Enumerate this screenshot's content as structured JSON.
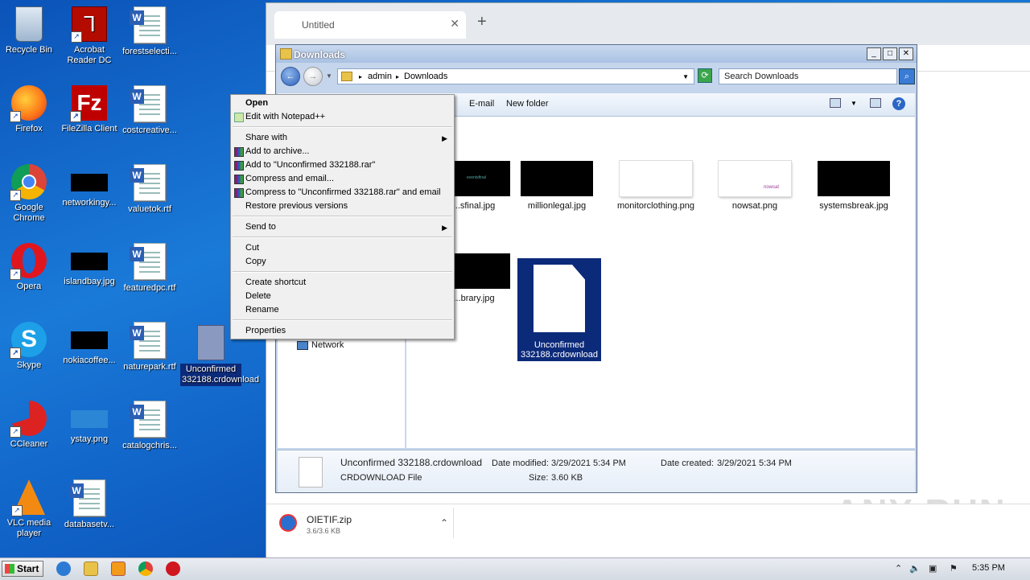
{
  "desktop": {
    "icons": [
      {
        "label": "Recycle Bin"
      },
      {
        "label": "Acrobat Reader DC"
      },
      {
        "label": "forestselecti..."
      },
      {
        "label": "Firefox"
      },
      {
        "label": "FileZilla Client"
      },
      {
        "label": "costcreative..."
      },
      {
        "label": "Google Chrome"
      },
      {
        "label": "networkingy..."
      },
      {
        "label": "valuetok.rtf"
      },
      {
        "label": "Opera"
      },
      {
        "label": "islandbay.jpg"
      },
      {
        "label": "featuredpc.rtf"
      },
      {
        "label": "Skype"
      },
      {
        "label": "nokiacoffee..."
      },
      {
        "label": "naturepark.rtf"
      },
      {
        "label": "Unconfirmed 332188.crdownload"
      },
      {
        "label": "CCleaner"
      },
      {
        "label": "ystay.png"
      },
      {
        "label": "catalogchris..."
      },
      {
        "label": "VLC media player"
      },
      {
        "label": "databasetv..."
      }
    ]
  },
  "chrome": {
    "tab_title": "Untitled",
    "tab_close": "✕",
    "new_tab": "+",
    "download": {
      "name": "OIETIF.zip",
      "size": "3.6/3.6 KB"
    },
    "watermark": "ANY RUN"
  },
  "explorer": {
    "title": "Downloads",
    "breadcrumb": [
      "admin",
      "Downloads"
    ],
    "search_placeholder": "Search Downloads",
    "toolbar": {
      "email": "E-mail",
      "new_folder": "New folder"
    },
    "nav_network": "Network",
    "files": [
      {
        "name": "...sfinal.jpg"
      },
      {
        "name": "millionlegal.jpg"
      },
      {
        "name": "monitorclothing.png"
      },
      {
        "name": "nowsat.png"
      },
      {
        "name": "systemsbreak.jpg"
      },
      {
        "name": "...brary.jpg"
      },
      {
        "name": "Unconfirmed 332188.crdownload"
      }
    ],
    "thumb_text": {
      "sfinal": "eventsfinal",
      "nowsat": "nowsat"
    },
    "details": {
      "name": "Unconfirmed 332188.crdownload",
      "type": "CRDOWNLOAD File",
      "modified_label": "Date modified:",
      "modified": "3/29/2021 5:34 PM",
      "created_label": "Date created:",
      "created": "3/29/2021 5:34 PM",
      "size_label": "Size:",
      "size": "3.60 KB"
    }
  },
  "context_menu": {
    "items": [
      "Open",
      "Edit with Notepad++",
      "Share with",
      "Add to archive...",
      "Add to \"Unconfirmed 332188.rar\"",
      "Compress and email...",
      "Compress to \"Unconfirmed 332188.rar\" and email",
      "Restore previous versions",
      "Send to",
      "Cut",
      "Copy",
      "Create shortcut",
      "Delete",
      "Rename",
      "Properties"
    ]
  },
  "taskbar": {
    "start": "Start",
    "clock": "5:35 PM"
  },
  "colors": {
    "desktop_blue": "#0b53b8",
    "selection": "#0c2a7a",
    "menu_bg": "#f0f0f0"
  }
}
